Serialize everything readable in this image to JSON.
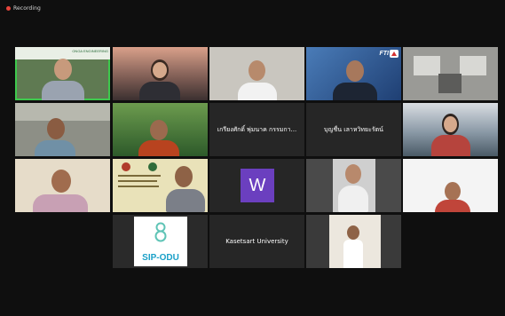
{
  "recording": {
    "label": "Recording",
    "color": "#e8453c"
  },
  "participants": [
    {
      "id": "r1c1",
      "kind": "video",
      "active": true
    },
    {
      "id": "r1c2",
      "kind": "video"
    },
    {
      "id": "r1c3",
      "kind": "video"
    },
    {
      "id": "r1c4",
      "kind": "video",
      "badge": "FTI"
    },
    {
      "id": "r1c5",
      "kind": "video"
    },
    {
      "id": "r2c1",
      "kind": "video"
    },
    {
      "id": "r2c2",
      "kind": "video"
    },
    {
      "id": "r2c3",
      "kind": "name",
      "name": "เกรียงศักดิ์ พุ่มนาค กรรมกา..."
    },
    {
      "id": "r2c4",
      "kind": "name",
      "name": "บุญชื่น เลาหวิทยะรัตน์"
    },
    {
      "id": "r2c5",
      "kind": "video"
    },
    {
      "id": "r3c1",
      "kind": "video"
    },
    {
      "id": "r3c2",
      "kind": "video"
    },
    {
      "id": "r3c3",
      "kind": "avatar",
      "initial": "W",
      "color": "#6b3fbf"
    },
    {
      "id": "r3c4",
      "kind": "video"
    },
    {
      "id": "r3c5",
      "kind": "video"
    },
    {
      "id": "r4c2",
      "kind": "logo",
      "logo_text": "SIP-ODU"
    },
    {
      "id": "r4c3",
      "kind": "name",
      "name": "Kasetsart University"
    },
    {
      "id": "r4c4",
      "kind": "video"
    }
  ]
}
